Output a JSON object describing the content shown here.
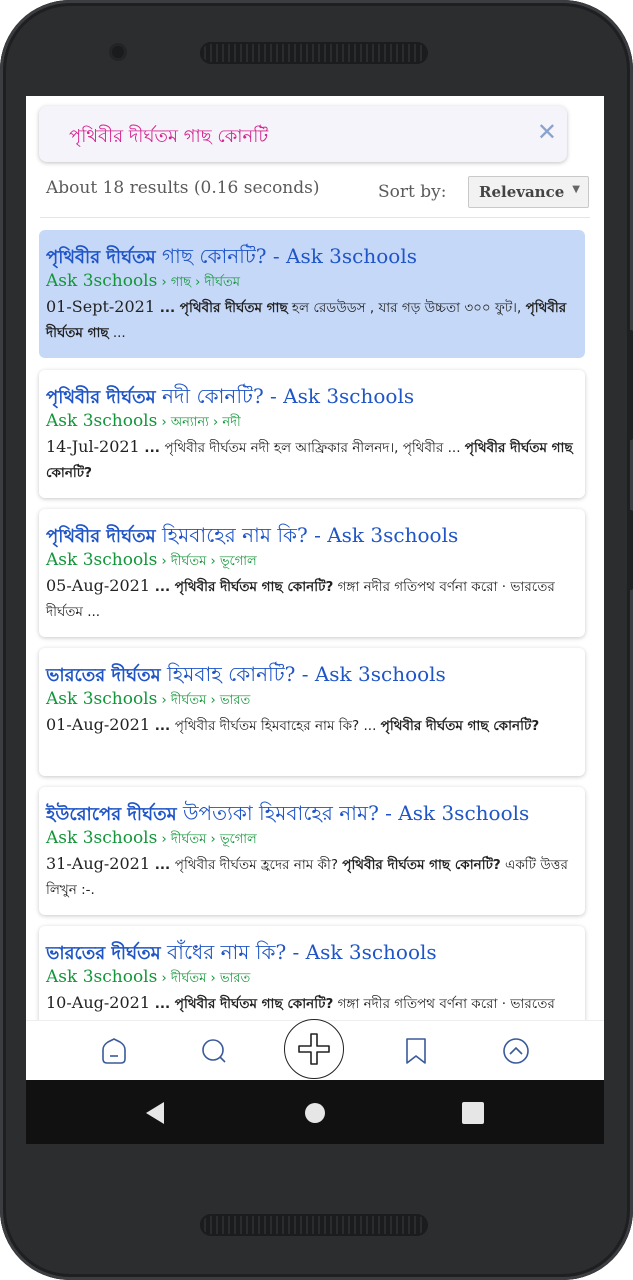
{
  "search": {
    "query": "পৃথিবীর দীর্ঘতম গাছ কোনটি",
    "clear_icon": "close-icon"
  },
  "results_info": "About 18 results (0.16 seconds)",
  "sort": {
    "label": "Sort by:",
    "selected": "Relevance"
  },
  "results": [
    {
      "title_bold": "পৃথিবীর দীর্ঘতম",
      "title_rest": " গাছ কোনটি? - Ask 3schools",
      "crumb_site": "Ask 3schools",
      "crumb_path": " › গাছ › দীর্ঘতম",
      "date": "01-Sept-2021",
      "ellipsis": " ... ",
      "snippet_bold1": "পৃথিবীর দীর্ঘতম গাছ",
      "snippet_text1": " হল রেডউডস , যার গড় উচ্চতা ৩০০ ফুট।, ",
      "snippet_bold2": "পৃথিবীর দীর্ঘতম গাছ",
      "snippet_text2": " ..."
    },
    {
      "title_bold": "পৃথিবীর দীর্ঘতম",
      "title_rest": " নদী কোনটি? - Ask 3schools",
      "crumb_site": "Ask 3schools",
      "crumb_path": " › অন্যান্য › নদী",
      "date": "14-Jul-2021",
      "ellipsis": " ... ",
      "snippet_bold1": "",
      "snippet_text1": "পৃথিবীর দীর্ঘতম নদী হল আফ্রিকার নীলনদ।, পৃথিবীর ... ",
      "snippet_bold2": "পৃথিবীর দীর্ঘতম গাছ কোনটি?",
      "snippet_text2": ""
    },
    {
      "title_bold": "পৃথিবীর দীর্ঘতম",
      "title_rest": " হিমবাহের নাম কি? - Ask 3schools",
      "crumb_site": "Ask 3schools",
      "crumb_path": " › দীর্ঘতম › ভূগোল",
      "date": "05-Aug-2021",
      "ellipsis": " ... ",
      "snippet_bold1": "পৃথিবীর দীর্ঘতম গাছ কোনটি?",
      "snippet_text1": " গঙ্গা নদীর গতিপথ বর্ণনা করো · ভারতের দীর্ঘতম ...",
      "snippet_bold2": "",
      "snippet_text2": ""
    },
    {
      "title_bold": "ভারতের দীর্ঘতম",
      "title_rest": " হিমবাহ কোনটি? - Ask 3schools",
      "crumb_site": "Ask 3schools",
      "crumb_path": " › দীর্ঘতম › ভারত",
      "date": "01-Aug-2021",
      "ellipsis": " ... ",
      "snippet_bold1": "",
      "snippet_text1": "পৃথিবীর দীর্ঘতম হিমবাহের নাম কি? ... ",
      "snippet_bold2": "পৃথিবীর দীর্ঘতম গাছ কোনটি?",
      "snippet_text2": ""
    },
    {
      "title_bold": "ইউরোপের দীর্ঘতম",
      "title_rest": " উপত্যকা হিমবাহের নাম? - Ask 3schools",
      "crumb_site": "Ask 3schools",
      "crumb_path": " › দীর্ঘতম › ভূগোল",
      "date": "31-Aug-2021",
      "ellipsis": " ... ",
      "snippet_bold1": "",
      "snippet_text1": "পৃথিবীর দীর্ঘতম হ্রদের নাম কী? ",
      "snippet_bold2": "পৃথিবীর দীর্ঘতম গাছ কোনটি?",
      "snippet_text2": " একটি উত্তর লিখুন :-."
    },
    {
      "title_bold": "ভারতের দীর্ঘতম",
      "title_rest": " বাঁধের নাম কি? - Ask 3schools",
      "crumb_site": "Ask 3schools",
      "crumb_path": " › দীর্ঘতম › ভারত",
      "date": "10-Aug-2021",
      "ellipsis": " ... ",
      "snippet_bold1": "পৃথিবীর দীর্ঘতম গাছ কোনটি?",
      "snippet_text1": " গঙ্গা নদীর গতিপথ বর্ণনা করো · ভারতের দীর্ঘতম ...",
      "snippet_bold2": "",
      "snippet_text2": ""
    }
  ],
  "bottom_bar": [
    "home-icon",
    "search-icon",
    "add-icon",
    "bookmark-icon",
    "scroll-up-icon"
  ],
  "android_nav": [
    "back-icon",
    "home-icon",
    "recents-icon"
  ],
  "colors": {
    "title": "#1f55c7",
    "url": "#13963a",
    "query": "#d4238f",
    "active_card": "#c6d8f8"
  }
}
